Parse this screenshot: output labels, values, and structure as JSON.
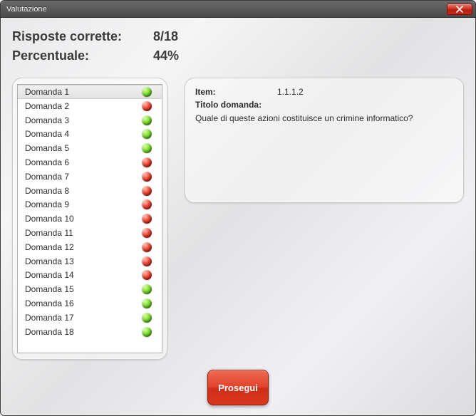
{
  "window": {
    "title": "Valutazione"
  },
  "summary": {
    "correct_label": "Risposte corrette:",
    "correct_value": "8/18",
    "percent_label": "Percentuale:",
    "percent_value": "44%"
  },
  "questions": [
    {
      "label": "Domanda 1",
      "status": "green",
      "selected": true
    },
    {
      "label": "Domanda 2",
      "status": "red",
      "selected": false
    },
    {
      "label": "Domanda 3",
      "status": "green",
      "selected": false
    },
    {
      "label": "Domanda 4",
      "status": "green",
      "selected": false
    },
    {
      "label": "Domanda 5",
      "status": "green",
      "selected": false
    },
    {
      "label": "Domanda 6",
      "status": "red",
      "selected": false
    },
    {
      "label": "Domanda 7",
      "status": "red",
      "selected": false
    },
    {
      "label": "Domanda 8",
      "status": "red",
      "selected": false
    },
    {
      "label": "Domanda 9",
      "status": "red",
      "selected": false
    },
    {
      "label": "Domanda 10",
      "status": "red",
      "selected": false
    },
    {
      "label": "Domanda 11",
      "status": "red",
      "selected": false
    },
    {
      "label": "Domanda 12",
      "status": "red",
      "selected": false
    },
    {
      "label": "Domanda 13",
      "status": "red",
      "selected": false
    },
    {
      "label": "Domanda 14",
      "status": "red",
      "selected": false
    },
    {
      "label": "Domanda 15",
      "status": "green",
      "selected": false
    },
    {
      "label": "Domanda 16",
      "status": "green",
      "selected": false
    },
    {
      "label": "Domanda 17",
      "status": "green",
      "selected": false
    },
    {
      "label": "Domanda 18",
      "status": "green",
      "selected": false
    }
  ],
  "detail": {
    "item_label": "Item:",
    "item_value": "1.1.1.2",
    "title_label": "Titolo domanda:",
    "question_text": "Quale di queste azioni costituisce un crimine informatico?"
  },
  "footer": {
    "proceed_label": "Prosegui"
  }
}
